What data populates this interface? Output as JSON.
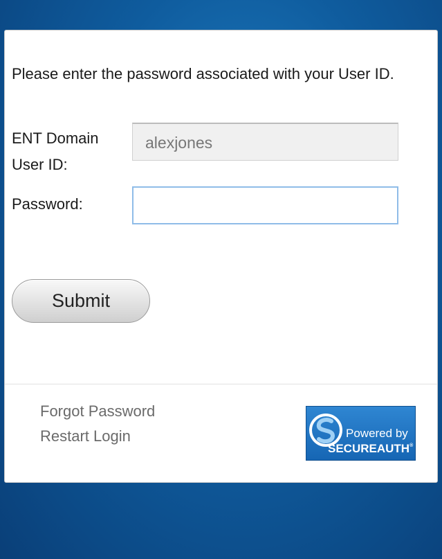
{
  "form": {
    "instructions": "Please enter the password associated with your User ID.",
    "user_label": "ENT Domain User ID:",
    "user_value": "alexjones",
    "password_label": "Password:",
    "password_value": "",
    "submit_label": "Submit"
  },
  "footer": {
    "forgot_password": "Forgot Password",
    "restart_login": "Restart Login",
    "badge": {
      "powered_by": "Powered by",
      "brand": "SECUREAUTH",
      "trademark": "®",
      "icon": "secureauth-logo-icon"
    }
  },
  "colors": {
    "background": "#0f5c9e",
    "badge": "#1f72c2",
    "focus_border": "#8fbce8",
    "link": "#6a6a6a"
  }
}
